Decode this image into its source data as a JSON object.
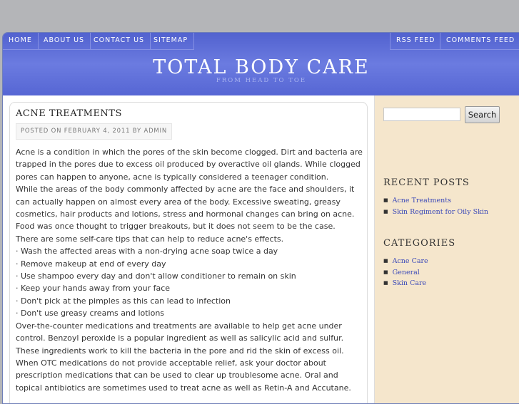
{
  "nav": {
    "left": [
      "HOME",
      "ABOUT US",
      "CONTACT US",
      "SITEMAP"
    ],
    "right": [
      "RSS FEED",
      "COMMENTS FEED"
    ]
  },
  "site": {
    "title": "TOTAL BODY CARE",
    "description": "FROM HEAD TO TOE"
  },
  "post": {
    "title": "ACNE TREATMENTS",
    "meta": "POSTED ON FEBRUARY 4, 2011 BY ADMIN",
    "lines": [
      "Acne is a condition in which the pores of the skin become clogged. Dirt and bacteria are trapped in the pores due to excess oil produced by overactive oil glands. While clogged pores can happen to anyone, acne is typically considered a teenager condition.",
      "While the areas of the body commonly affected by acne are the face and shoulders, it can actually happen on almost every area of the body. Excessive sweating, greasy cosmetics, hair products and lotions, stress and hormonal changes can bring on acne. Food was once thought to trigger breakouts, but it does not seem to be the case.",
      "There are some self-care tips that can help to reduce acne's effects.",
      "· Wash the affected areas with a non-drying acne soap twice a day",
      "· Remove makeup at end of every day",
      "· Use shampoo every day and don't allow conditioner to remain on skin",
      "· Keep your hands away from your face",
      "· Don't pick at the pimples as this can lead to infection",
      "· Don't use greasy creams and lotions",
      "Over-the-counter medications and treatments are available to help get acne under control. Benzoyl peroxide is a popular ingredient as well as salicylic acid and sulfur. These ingredients work to kill the bacteria in the pore and rid the skin of excess oil. When OTC medications do not provide acceptable relief, ask your doctor about prescription medications that can be used to clear up troublesome acne. Oral and topical antibiotics are sometimes used to treat acne as well as Retin-A and Accutane."
    ]
  },
  "sidebar": {
    "search_button": "Search",
    "search_value": "",
    "recent_title": "RECENT POSTS",
    "recent": [
      "Acne Treatments",
      "Skin Regiment for Oily Skin"
    ],
    "categories_title": "CATEGORIES",
    "categories": [
      "Acne Care",
      "General",
      "Skin Care"
    ]
  },
  "colors": {
    "header": "#5a6ad8",
    "link": "#3b49b8",
    "sidebar_bg": "#f5e6cc",
    "page_bg": "#b4b5b8"
  }
}
